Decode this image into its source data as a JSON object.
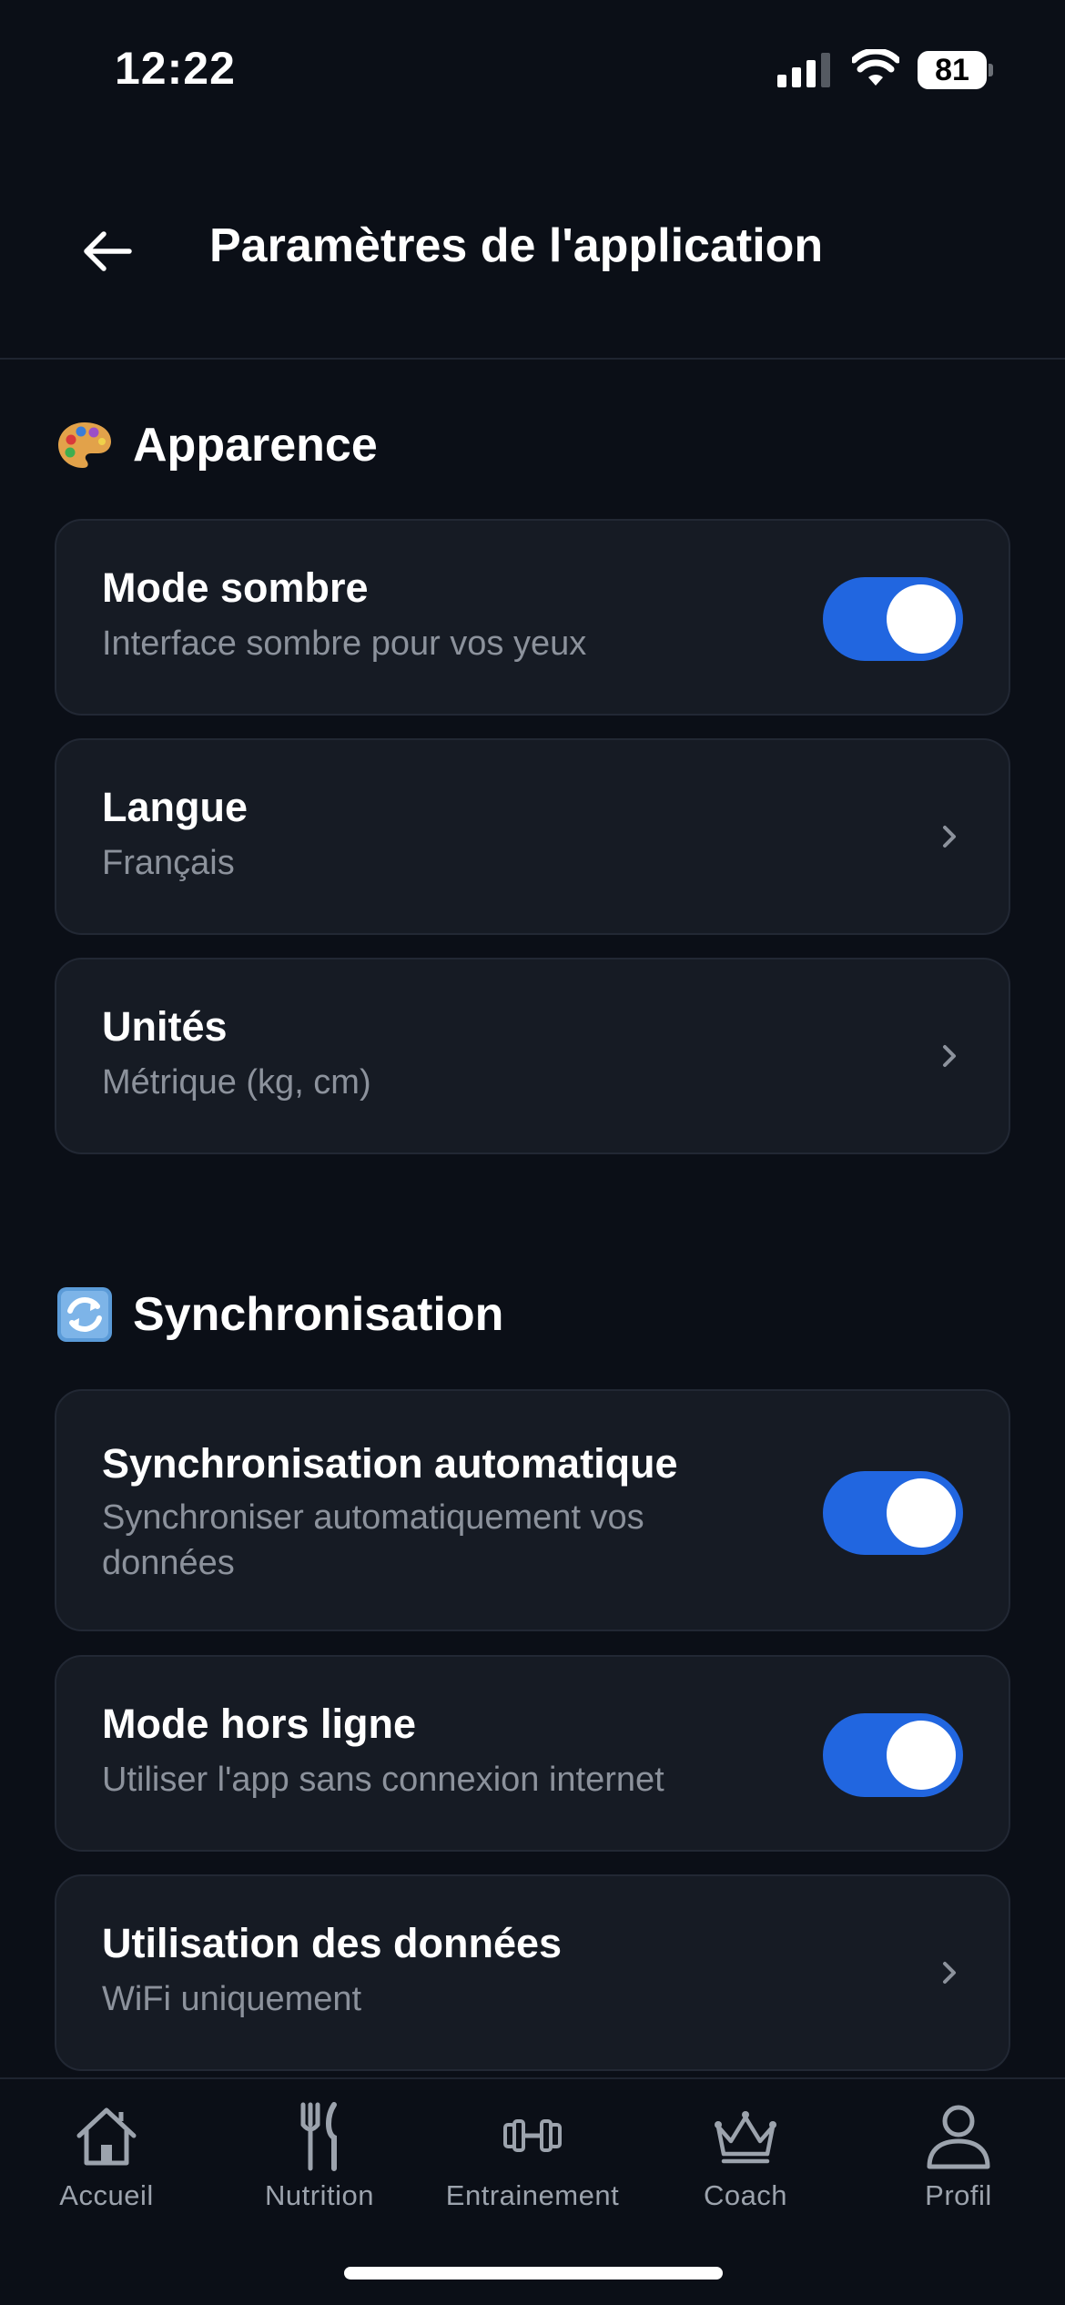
{
  "status_bar": {
    "time": "12:22",
    "battery": "81"
  },
  "header": {
    "title": "Paramètres de l'application"
  },
  "sections": [
    {
      "title": "Apparence",
      "emoji": "artist-palette-icon",
      "items": [
        {
          "title": "Mode sombre",
          "subtitle": "Interface sombre pour vos yeux",
          "control": "toggle",
          "on": true
        },
        {
          "title": "Langue",
          "subtitle": "Français",
          "control": "chevron"
        },
        {
          "title": "Unités",
          "subtitle": "Métrique (kg, cm)",
          "control": "chevron"
        }
      ]
    },
    {
      "title": "Synchronisation",
      "emoji": "sync-arrows-icon",
      "items": [
        {
          "title": "Synchronisation automatique",
          "subtitle": "Synchroniser automatiquement vos données",
          "control": "toggle",
          "on": true
        },
        {
          "title": "Mode hors ligne",
          "subtitle": "Utiliser l'app sans connexion internet",
          "control": "toggle",
          "on": true
        },
        {
          "title": "Utilisation des données",
          "subtitle": "WiFi uniquement",
          "control": "chevron"
        }
      ]
    }
  ],
  "bottom_nav": [
    {
      "label": "Accueil",
      "icon": "home-icon"
    },
    {
      "label": "Nutrition",
      "icon": "fork-knife-icon"
    },
    {
      "label": "Entrainement",
      "icon": "dumbbell-icon"
    },
    {
      "label": "Coach",
      "icon": "crown-icon"
    },
    {
      "label": "Profil",
      "icon": "user-icon"
    }
  ],
  "colors": {
    "background": "#0b0f17",
    "card": "#161b24",
    "accent": "#2166e0",
    "muted_text": "#8c929c"
  }
}
